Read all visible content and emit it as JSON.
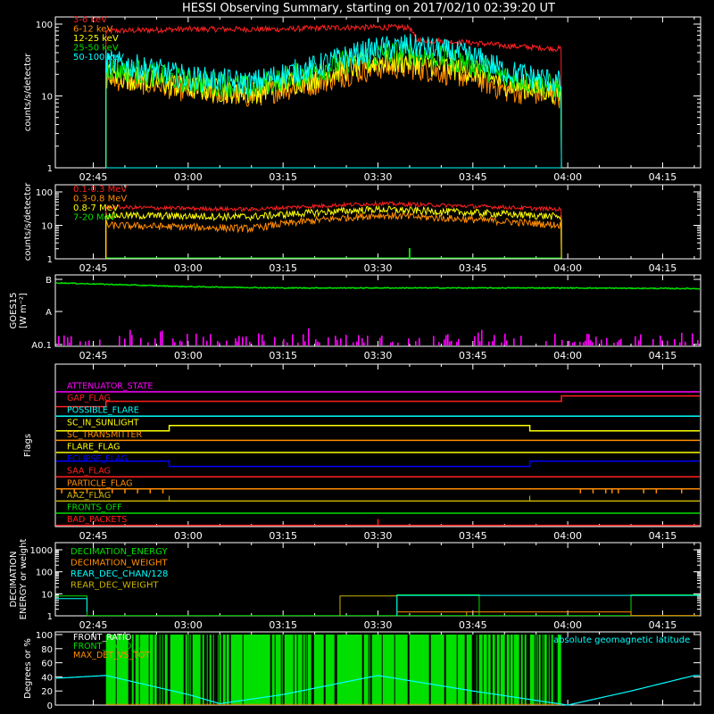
{
  "title": "HESSI Observing Summary, starting on 2017/02/10 02:39:20 UT",
  "time_ticks": [
    "02:45",
    "03:00",
    "03:15",
    "03:30",
    "03:45",
    "04:00",
    "04:15"
  ],
  "chart_data": [
    {
      "type": "line",
      "ylabel": "counts/s/detector",
      "yscale": "log",
      "ylim": [
        1,
        100
      ],
      "yticks": [
        "1",
        "10",
        "100"
      ],
      "data_window": [
        "02:47",
        "03:59"
      ],
      "series": [
        {
          "name": "3-6 keV",
          "color": "#ff2020",
          "times": [
            "02:47",
            "03:00",
            "03:15",
            "03:25",
            "03:35",
            "03:36",
            "03:45",
            "03:50",
            "03:59"
          ],
          "values": [
            80,
            85,
            85,
            90,
            90,
            60,
            55,
            50,
            45
          ]
        },
        {
          "name": "6-12 keV",
          "color": "#ff8c00",
          "times": [
            "02:47",
            "03:00",
            "03:10",
            "03:20",
            "03:30",
            "03:35",
            "03:45",
            "03:50",
            "03:59"
          ],
          "values": [
            18,
            12,
            10,
            15,
            25,
            25,
            18,
            12,
            10
          ]
        },
        {
          "name": "12-25 keV",
          "color": "#ffff00",
          "times": [
            "02:47",
            "03:00",
            "03:10",
            "03:20",
            "03:30",
            "03:35",
            "03:45",
            "03:50",
            "03:59"
          ],
          "values": [
            20,
            13,
            11,
            18,
            30,
            30,
            22,
            15,
            11
          ]
        },
        {
          "name": "25-50 keV",
          "color": "#00e000",
          "times": [
            "02:47",
            "03:00",
            "03:10",
            "03:20",
            "03:30",
            "03:35",
            "03:45",
            "03:50",
            "03:59"
          ],
          "values": [
            25,
            16,
            13,
            22,
            38,
            40,
            28,
            18,
            13
          ]
        },
        {
          "name": "50-100 keV",
          "color": "#00ffff",
          "times": [
            "02:47",
            "03:00",
            "03:10",
            "03:20",
            "03:30",
            "03:35",
            "03:45",
            "03:50",
            "03:59"
          ],
          "values": [
            30,
            18,
            15,
            25,
            45,
            50,
            35,
            22,
            15
          ]
        }
      ]
    },
    {
      "type": "line",
      "ylabel": "counts/s/detector",
      "yscale": "log",
      "ylim": [
        1,
        100
      ],
      "yticks": [
        "1",
        "10",
        "100"
      ],
      "data_window": [
        "02:47",
        "03:59"
      ],
      "series": [
        {
          "name": "0.1-0.3 MeV",
          "color": "#ff2020",
          "times": [
            "02:47",
            "03:10",
            "03:30",
            "03:59"
          ],
          "values": [
            35,
            30,
            45,
            30
          ]
        },
        {
          "name": "0.3-0.8 MeV",
          "color": "#ff8c00",
          "times": [
            "02:47",
            "03:10",
            "03:30",
            "03:59"
          ],
          "values": [
            10,
            8,
            20,
            10
          ]
        },
        {
          "name": "0.8-7 MeV",
          "color": "#ffff00",
          "times": [
            "02:47",
            "03:10",
            "03:30",
            "03:59"
          ],
          "values": [
            20,
            18,
            30,
            18
          ]
        },
        {
          "name": "7-20 MeV",
          "color": "#00e000",
          "times": [
            "02:47",
            "03:59"
          ],
          "values": [
            1,
            1
          ]
        }
      ]
    },
    {
      "type": "line",
      "ylabel": "GOES15 [W m-2]",
      "ylabel_lines": [
        "GOES15",
        "[W m⁻²]"
      ],
      "yticks": [
        "A0.1",
        "A",
        "B"
      ],
      "series": [
        {
          "name": "GOES15",
          "color": "#00e000",
          "times": [
            "02:39",
            "03:00",
            "03:15",
            "03:30",
            "03:45",
            "04:00",
            "04:20"
          ],
          "values": [
            0.96,
            0.9,
            0.88,
            0.88,
            0.88,
            0.88,
            0.87
          ]
        }
      ]
    },
    {
      "type": "flags",
      "ylabel": "Flags",
      "flags": [
        {
          "name": "ATTENUATOR_STATE",
          "color": "#ff00ff"
        },
        {
          "name": "GAP_FLAG",
          "color": "#ff2020"
        },
        {
          "name": "POSSIBLE_FLARE",
          "color": "#00ffff"
        },
        {
          "name": "SC_IN_SUNLIGHT",
          "color": "#ffff00"
        },
        {
          "name": "SC_TRANSMITTER",
          "color": "#ff8c00"
        },
        {
          "name": "FLARE_FLAG",
          "color": "#ffff00"
        },
        {
          "name": "ECLIPSE_FLAG",
          "color": "#0000ff"
        },
        {
          "name": "SAA_FLAG",
          "color": "#ff2020"
        },
        {
          "name": "PARTICLE_FLAG",
          "color": "#ff8c00"
        },
        {
          "name": "AAZ_FLAG",
          "color": "#c8b400"
        },
        {
          "name": "FRONTS_OFF",
          "color": "#00e000"
        },
        {
          "name": "BAD_PACKETS",
          "color": "#ff2020"
        }
      ]
    },
    {
      "type": "line",
      "ylabel": "DECIMATION ENERGY or weight",
      "ylabel_lines": [
        "DECIMATION",
        "ENERGY or weight"
      ],
      "yscale": "log",
      "ylim": [
        1,
        1000
      ],
      "yticks": [
        "1",
        "10",
        "100",
        "1000"
      ],
      "series": [
        {
          "name": "DECIMATION_ENERGY",
          "color": "#00e000"
        },
        {
          "name": "DECIMATION_WEIGHT",
          "color": "#ff8c00"
        },
        {
          "name": "REAR_DEC_CHAN/128",
          "color": "#00ffff"
        },
        {
          "name": "REAR_DEC_WEIGHT",
          "color": "#c8b400"
        }
      ]
    },
    {
      "type": "line",
      "ylabel": "Degrees or %",
      "ylim": [
        0,
        100
      ],
      "yticks": [
        "0",
        "20",
        "40",
        "60",
        "80",
        "100"
      ],
      "series": [
        {
          "name": "FRONT_RATIO",
          "color": "#00e000"
        },
        {
          "name": "FRONT_RATIO_...",
          "color": "#00e000"
        },
        {
          "name": "MAX_DET_VS_TOT",
          "color": "#ff8c00"
        },
        {
          "name": "absolute geomagnetic latitude",
          "color": "#00ffff",
          "times": [
            "02:39",
            "02:47",
            "03:00",
            "03:05",
            "03:15",
            "03:30",
            "03:45",
            "04:00",
            "04:10",
            "04:20"
          ],
          "values": [
            38,
            42,
            15,
            2,
            15,
            42,
            20,
            0,
            20,
            42
          ]
        }
      ]
    }
  ]
}
